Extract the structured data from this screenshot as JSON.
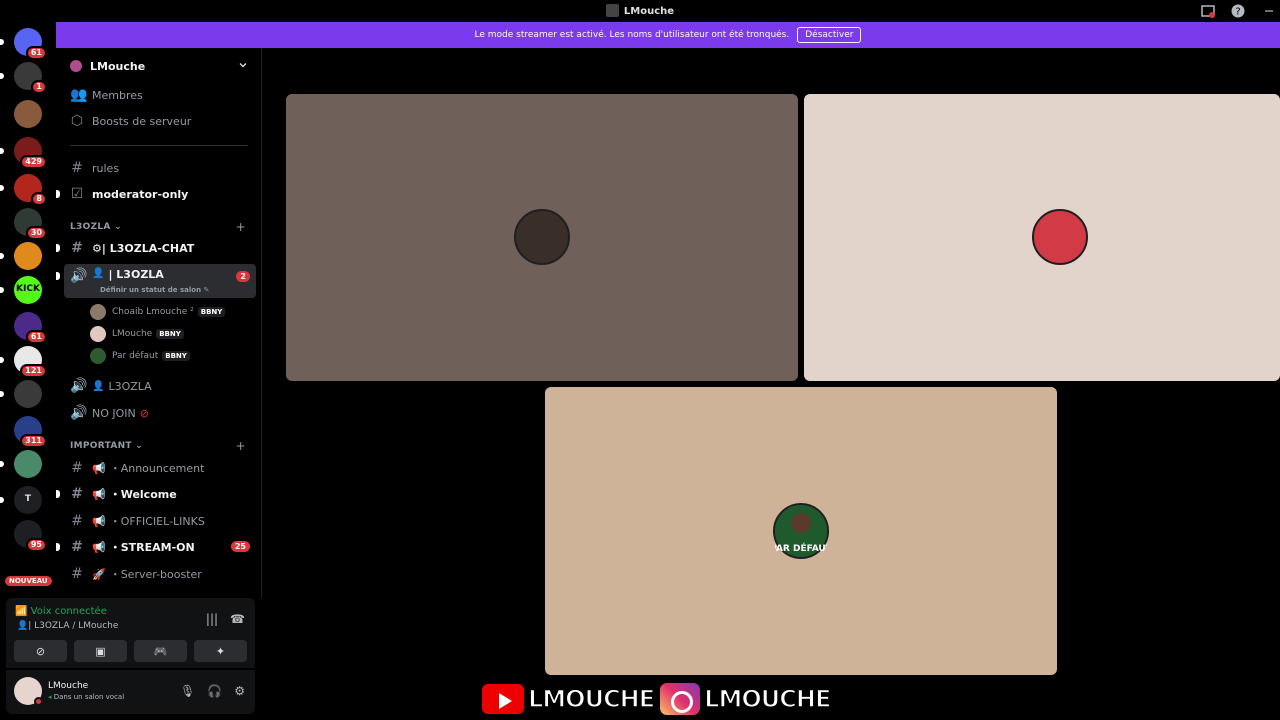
{
  "window": {
    "title": "LMouche"
  },
  "banner": {
    "text": "Le mode streamer est activé. Les noms d'utilisateur ont été tronqués.",
    "button": "Désactiver"
  },
  "guilds": [
    {
      "badge": "61",
      "color": "#5865f2"
    },
    {
      "badge": "1",
      "color": "#3a3a3a"
    },
    {
      "badge": "",
      "color": "#8a5a3c"
    },
    {
      "badge": "429",
      "color": "#7a1c1c"
    },
    {
      "badge": "8",
      "color": "#b3261e"
    },
    {
      "badge": "30",
      "color": "#2f3a34"
    },
    {
      "badge": "",
      "color": "#e08a1e"
    },
    {
      "badge": "",
      "color": "#53fc18",
      "label": "KICK"
    },
    {
      "badge": "61",
      "color": "#4b2a8a"
    },
    {
      "badge": "121",
      "color": "#e8e8e8"
    },
    {
      "badge": "",
      "color": "#3a3a3a"
    },
    {
      "badge": "311",
      "color": "#2a3f8a"
    },
    {
      "badge": "",
      "color": "#4a8a6a"
    },
    {
      "badge": "",
      "color": "#1e1f22",
      "label": "T"
    },
    {
      "badge": "95",
      "color": "#1e1f22"
    }
  ],
  "nouveau": "NOUVEAU",
  "server": {
    "name": "LMouche",
    "links": [
      {
        "label": "Membres"
      },
      {
        "label": "Boosts de serveur"
      }
    ],
    "channels_top": [
      {
        "label": "rules"
      },
      {
        "label": "moderator-only"
      }
    ],
    "categories": [
      {
        "label": "L3OZLA"
      },
      {
        "label": "IMPORTANT"
      }
    ],
    "l3ozla_chat": "⚙| L3OZLA-CHAT",
    "voice_active": {
      "label": "| L3OZLA",
      "unread": "2",
      "status": "Définir un statut de salon"
    },
    "members": [
      {
        "name": "Choaib Lmouche ²",
        "tag": "BBNY"
      },
      {
        "name": "LMouche",
        "tag": "BBNY"
      },
      {
        "name": "Par défaut",
        "tag": "BBNY"
      }
    ],
    "voice_2": "L3OZLA",
    "voice_3": "NO JOIN",
    "important_channels": [
      {
        "label": "・Announcement"
      },
      {
        "label": "・Welcome"
      },
      {
        "label": "・OFFICIEL-LINKS"
      },
      {
        "label": "・STREAM-ON",
        "unread": "25"
      },
      {
        "label": "・Server-booster"
      }
    ]
  },
  "voice_panel": {
    "status": "Voix connectée",
    "channel": "| L3OZLA / LMouche"
  },
  "user": {
    "name": "LMouche",
    "status": "Dans un salon vocal"
  },
  "tiles": [
    {
      "bg": "#6f605a"
    },
    {
      "bg": "#e2d4ca"
    },
    {
      "bg": "#cfb398",
      "avatar_text": "PAR DÉFAUT"
    }
  ],
  "overlay": {
    "handle1": "LMOUCHE",
    "handle2": "LMOUCHE"
  }
}
